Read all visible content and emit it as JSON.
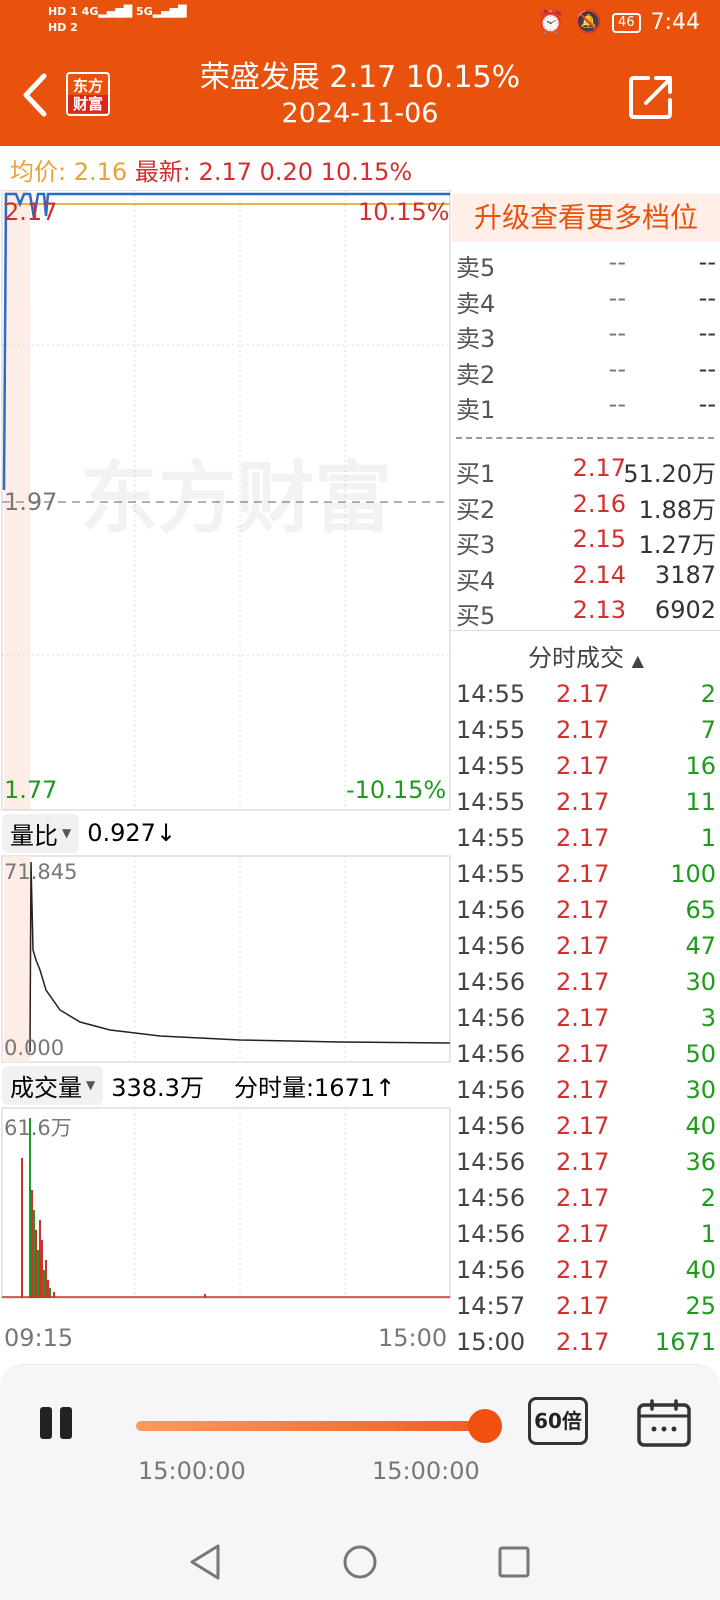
{
  "status_bar": {
    "hd1": "HD 1",
    "hd2": "HD 2",
    "net1": "4G",
    "net2": "5G",
    "battery": "46",
    "time": "7:44"
  },
  "header": {
    "logo_line1": "东方",
    "logo_line2": "财富",
    "title": "荣盛发展  2.17  10.15%",
    "date": "2024-11-06"
  },
  "info_line": {
    "avg_label": "均价:",
    "avg_value": "2.16",
    "latest_label": "最新:",
    "latest_value": "2.17",
    "change": "0.20",
    "change_pct": "10.15%"
  },
  "price_chart": {
    "y_top": "2.17",
    "y_top_pct": "10.15%",
    "y_mid": "1.97",
    "y_bottom": "1.77",
    "y_bottom_pct": "-10.15%",
    "watermark": "东方财富",
    "price_line_color": "#2B6CC4",
    "avg_line_color": "#E6B84A"
  },
  "volume_ratio": {
    "dropdown_label": "量比",
    "value": "0.927↓",
    "max_label": "71.845",
    "min_label": "0.000"
  },
  "volume": {
    "dropdown_label": "成交量",
    "total": "338.3万",
    "minute_label": "分时量:1671↑",
    "max_label": "61.6万",
    "x_start": "09:15",
    "x_end": "15:00"
  },
  "order_book": {
    "upgrade_label": "升级查看更多档位",
    "asks": [
      {
        "label": "卖5",
        "price": "--",
        "volume": "--"
      },
      {
        "label": "卖4",
        "price": "--",
        "volume": "--"
      },
      {
        "label": "卖3",
        "price": "--",
        "volume": "--"
      },
      {
        "label": "卖2",
        "price": "--",
        "volume": "--"
      },
      {
        "label": "卖1",
        "price": "--",
        "volume": "--"
      }
    ],
    "bids": [
      {
        "label": "买1",
        "price": "2.17",
        "volume": "51.20万"
      },
      {
        "label": "买2",
        "price": "2.16",
        "volume": "1.88万"
      },
      {
        "label": "买3",
        "price": "2.15",
        "volume": "1.27万"
      },
      {
        "label": "买4",
        "price": "2.14",
        "volume": "3187"
      },
      {
        "label": "买5",
        "price": "2.13",
        "volume": "6902"
      }
    ]
  },
  "trades": {
    "header": "分时成交",
    "rows": [
      {
        "time": "14:55",
        "price": "2.17",
        "volume": "2"
      },
      {
        "time": "14:55",
        "price": "2.17",
        "volume": "7"
      },
      {
        "time": "14:55",
        "price": "2.17",
        "volume": "16"
      },
      {
        "time": "14:55",
        "price": "2.17",
        "volume": "11"
      },
      {
        "time": "14:55",
        "price": "2.17",
        "volume": "1"
      },
      {
        "time": "14:55",
        "price": "2.17",
        "volume": "100"
      },
      {
        "time": "14:56",
        "price": "2.17",
        "volume": "65"
      },
      {
        "time": "14:56",
        "price": "2.17",
        "volume": "47"
      },
      {
        "time": "14:56",
        "price": "2.17",
        "volume": "30"
      },
      {
        "time": "14:56",
        "price": "2.17",
        "volume": "3"
      },
      {
        "time": "14:56",
        "price": "2.17",
        "volume": "50"
      },
      {
        "time": "14:56",
        "price": "2.17",
        "volume": "30"
      },
      {
        "time": "14:56",
        "price": "2.17",
        "volume": "40"
      },
      {
        "time": "14:56",
        "price": "2.17",
        "volume": "36"
      },
      {
        "time": "14:56",
        "price": "2.17",
        "volume": "2"
      },
      {
        "time": "14:56",
        "price": "2.17",
        "volume": "1"
      },
      {
        "time": "14:56",
        "price": "2.17",
        "volume": "40"
      },
      {
        "time": "14:57",
        "price": "2.17",
        "volume": "25"
      },
      {
        "time": "15:00",
        "price": "2.17",
        "volume": "1671"
      }
    ]
  },
  "playback": {
    "progress": 1.0,
    "time_left": "15:00:00",
    "time_right": "15:00:00",
    "speed": "60倍"
  },
  "colors": {
    "brand": "#E9520C",
    "up": "#D32F2F",
    "down": "#1E9B1E"
  }
}
